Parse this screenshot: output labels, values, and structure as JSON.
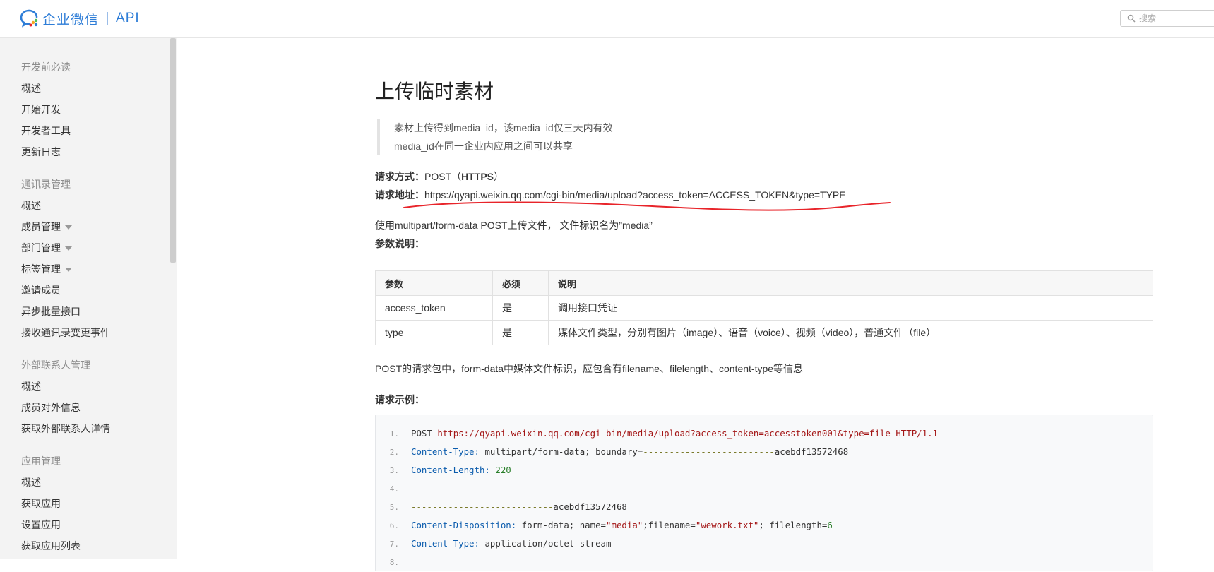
{
  "header": {
    "brand": "企业微信",
    "section": "API",
    "search_placeholder": "搜索"
  },
  "sidebar": {
    "groups": [
      {
        "heading": "开发前必读",
        "items": [
          {
            "label": "概述"
          },
          {
            "label": "开始开发"
          },
          {
            "label": "开发者工具"
          },
          {
            "label": "更新日志"
          }
        ]
      },
      {
        "heading": "通讯录管理",
        "items": [
          {
            "label": "概述"
          },
          {
            "label": "成员管理"
          },
          {
            "label": "部门管理"
          },
          {
            "label": "标签管理"
          },
          {
            "label": "邀请成员"
          },
          {
            "label": "异步批量接口"
          },
          {
            "label": "接收通讯录变更事件"
          }
        ]
      },
      {
        "heading": "外部联系人管理",
        "items": [
          {
            "label": "概述"
          },
          {
            "label": "成员对外信息"
          },
          {
            "label": "获取外部联系人详情"
          }
        ]
      },
      {
        "heading": "应用管理",
        "items": [
          {
            "label": "概述"
          },
          {
            "label": "获取应用"
          },
          {
            "label": "设置应用"
          },
          {
            "label": "获取应用列表"
          }
        ]
      }
    ]
  },
  "main": {
    "title": "上传临时素材",
    "notes": [
      "素材上传得到media_id，该media_id仅三天内有效",
      "media_id在同一企业内应用之间可以共享"
    ],
    "method_label": "请求方式：",
    "method_value": "POST（",
    "method_protocol": "HTTPS",
    "method_close": "）",
    "url_label": "请求地址：",
    "url_value": "https://qyapi.weixin.qq.com/cgi-bin/media/upload?access_token=ACCESS_TOKEN&type=TYPE",
    "upload_desc": "使用multipart/form-data POST上传文件， 文件标识名为”media”",
    "params_label": "参数说明：",
    "table": {
      "headers": [
        "参数",
        "必须",
        "说明"
      ],
      "rows": [
        [
          "access_token",
          "是",
          "调用接口凭证"
        ],
        [
          "type",
          "是",
          "媒体文件类型，分别有图片（image）、语音（voice）、视频（video），普通文件（file）"
        ]
      ]
    },
    "post_note": "POST的请求包中，form-data中媒体文件标识，应包含有filename、filelength、content-type等信息",
    "example_label": "请求示例：",
    "code": {
      "line_numbers": [
        "1.",
        "2.",
        "3.",
        "4.",
        "5.",
        "6.",
        "7.",
        "8."
      ],
      "l1_method": "POST ",
      "l1_url": "https://qyapi.weixin.qq.com/cgi-bin/media/upload?access_token=accesstoken001&type=file HTTP/1.1",
      "l2_key": "Content-Type:",
      "l2_val": " multipart/form-data; boundary=",
      "l2_dash": "-------------------------",
      "l2_id": "acebdf13572468",
      "l3_key": "Content-Length:",
      "l3_val": " 220",
      "l5_dash": "---------------------------",
      "l5_id": "acebdf13572468",
      "l6_key": "Content-Disposition:",
      "l6_a": " form-data; name=",
      "l6_b": "\"media\"",
      "l6_c": ";filename=",
      "l6_d": "\"wework.txt\"",
      "l6_e": "; filelength=",
      "l6_f": "6",
      "l7_key": "Content-Type:",
      "l7_val": " application/octet-stream"
    }
  },
  "colors": {
    "brand": "#2e7dd7",
    "annotation": "#e8242a"
  }
}
